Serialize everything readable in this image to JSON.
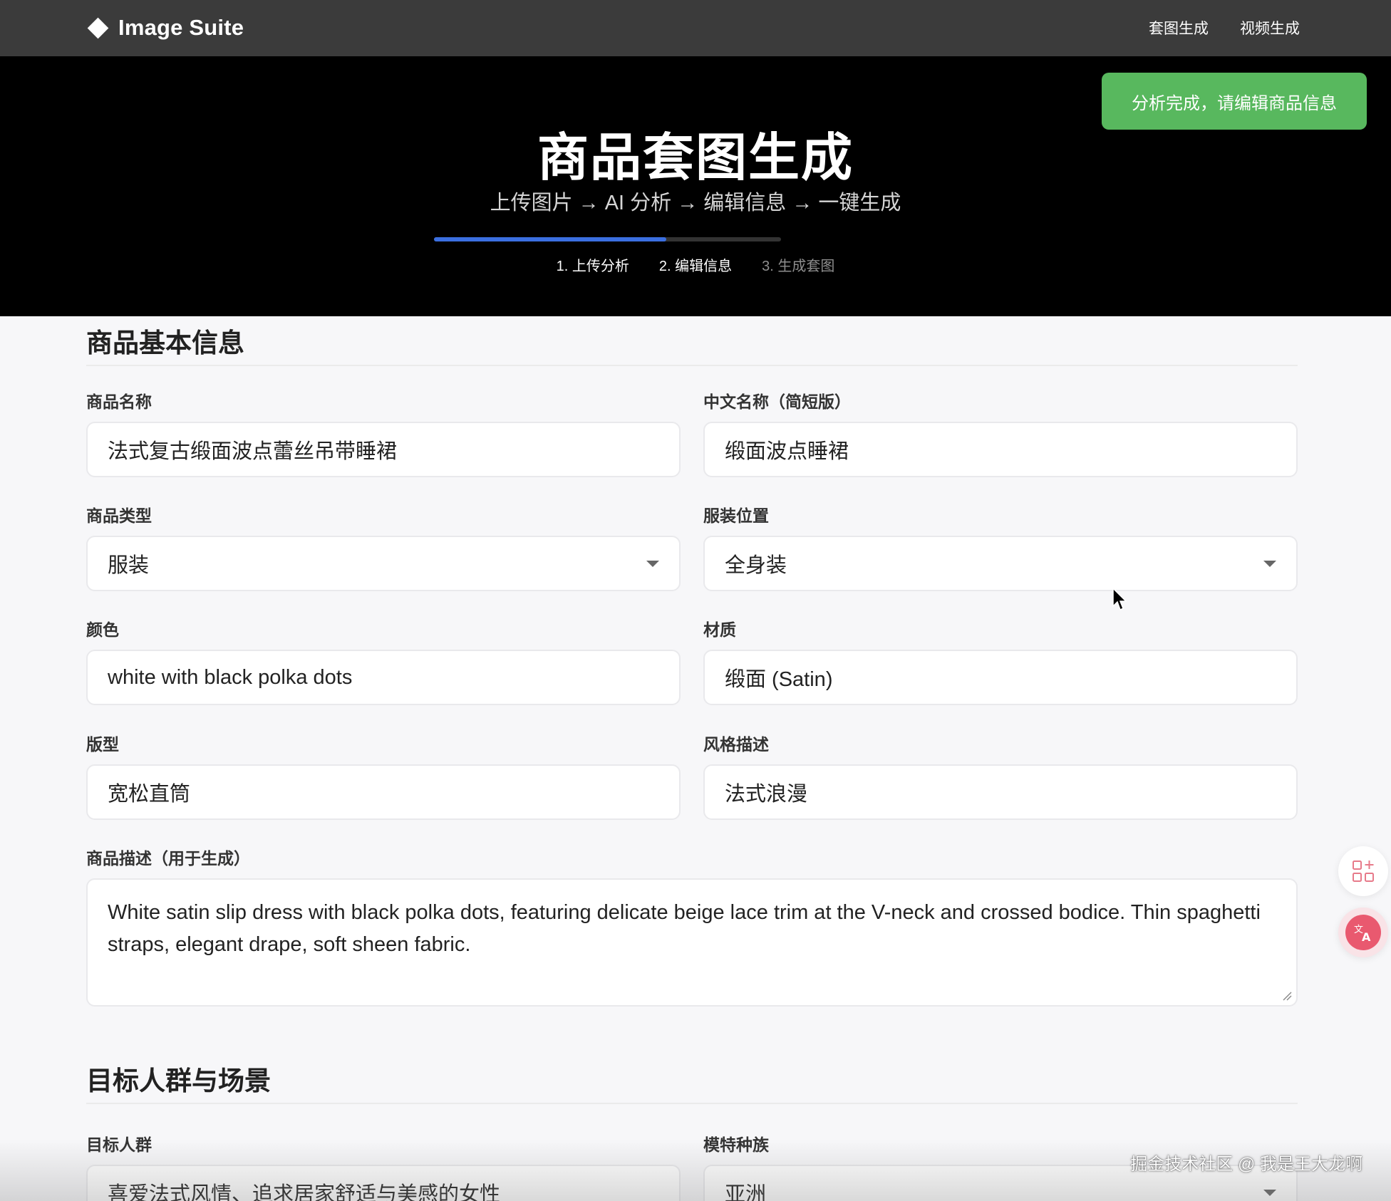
{
  "header": {
    "brand": "Image Suite",
    "nav": [
      "套图生成",
      "视频生成"
    ]
  },
  "hero": {
    "title": "商品套图生成",
    "subtitle": "上传图片 → AI 分析 → 编辑信息 → 一键生成",
    "progress_fraction": 0.67,
    "steps": [
      {
        "label": "1. 上传分析",
        "state": "done"
      },
      {
        "label": "2. 编辑信息",
        "state": "done"
      },
      {
        "label": "3. 生成套图",
        "state": "pending"
      }
    ]
  },
  "toast": {
    "text": "分析完成，请编辑商品信息",
    "color": "#58b85e"
  },
  "basic_info": {
    "title": "商品基本信息",
    "product_name": {
      "label": "商品名称",
      "value": "法式复古缎面波点蕾丝吊带睡裙"
    },
    "short_name": {
      "label": "中文名称（简短版）",
      "value": "缎面波点睡裙"
    },
    "product_type": {
      "label": "商品类型",
      "value": "服装"
    },
    "garment_position": {
      "label": "服装位置",
      "value": "全身装"
    },
    "color": {
      "label": "颜色",
      "value": "white with black polka dots"
    },
    "material": {
      "label": "材质",
      "value": "缎面 (Satin)"
    },
    "fit": {
      "label": "版型",
      "value": "宽松直筒"
    },
    "style": {
      "label": "风格描述",
      "value": "法式浪漫"
    },
    "description": {
      "label": "商品描述（用于生成）",
      "value": "White satin slip dress with black polka dots, featuring delicate beige lace trim at the V-neck and crossed bodice. Thin spaghetti straps, elegant drape, soft sheen fabric."
    }
  },
  "audience": {
    "title": "目标人群与场景",
    "target_group": {
      "label": "目标人群",
      "value": "喜爱法式风情、追求居家舒适与美感的女性"
    },
    "model_ethnicity": {
      "label": "模特种族",
      "value": "亚洲"
    }
  },
  "watermark": "掘金技术社区 @ 我是王大龙啊",
  "icons": [
    "diamond-logo-icon",
    "grid-plus-icon",
    "translate-icon",
    "chevron-down-icon",
    "mouse-cursor-icon"
  ]
}
